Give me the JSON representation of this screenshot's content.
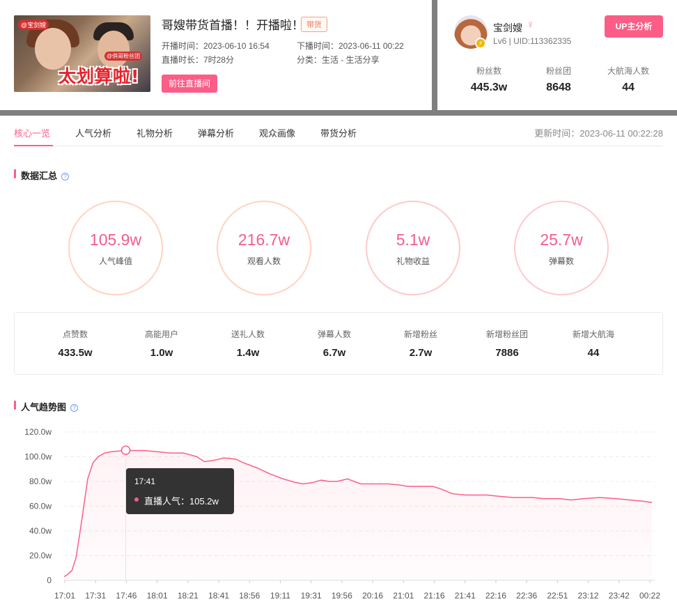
{
  "live": {
    "thumb_caption": "太划算啦!",
    "thumb_tag1": "@宝剑嫂",
    "thumb_tag2": "@俏哥粉丝团",
    "title": "哥嫂带货首播！！开播啦！",
    "badge": "带货",
    "start_time": "开播时间：2023-06-10 16:54",
    "end_time": "下播时间：2023-06-11 00:22",
    "duration": "直播时长：7时28分",
    "category": "分类：生活 - 生活分享",
    "go_button": "前往直播间"
  },
  "up": {
    "name": "宝剑嫂",
    "gender_icon": "♀",
    "uid": "Lv6 | UID:113362335",
    "analyze_button": "UP主分析",
    "stats": [
      {
        "label": "粉丝数",
        "value": "445.3w"
      },
      {
        "label": "粉丝团",
        "value": "8648"
      },
      {
        "label": "大航海人数",
        "value": "44"
      }
    ]
  },
  "tabs": [
    "核心一览",
    "人气分析",
    "礼物分析",
    "弹幕分析",
    "观众画像",
    "带货分析"
  ],
  "updated": "更新时间：2023-06-11 00:22:28",
  "summary": {
    "title": "数据汇总",
    "rings": [
      {
        "value": "105.9w",
        "label": "人气峰值"
      },
      {
        "value": "216.7w",
        "label": "观看人数"
      },
      {
        "value": "5.1w",
        "label": "礼物收益"
      },
      {
        "value": "25.7w",
        "label": "弹幕数"
      }
    ],
    "stats": [
      {
        "label": "点赞数",
        "value": "433.5w"
      },
      {
        "label": "高能用户",
        "value": "1.0w"
      },
      {
        "label": "送礼人数",
        "value": "1.4w"
      },
      {
        "label": "弹幕人数",
        "value": "6.7w"
      },
      {
        "label": "新增粉丝",
        "value": "2.7w"
      },
      {
        "label": "新增粉丝团",
        "value": "7886"
      },
      {
        "label": "新增大航海",
        "value": "44"
      }
    ]
  },
  "trend": {
    "title": "人气趋势图",
    "tooltip_time": "17:41",
    "tooltip_value": "直播人气：105.2w"
  },
  "chart_data": {
    "type": "area",
    "title": "人气趋势图",
    "xlabel": "",
    "ylabel": "",
    "ylim": [
      0,
      120
    ],
    "y_ticks": [
      "0",
      "20.0w",
      "40.0w",
      "60.0w",
      "80.0w",
      "100.0w",
      "120.0w"
    ],
    "x_ticks": [
      "17:01",
      "17:31",
      "17:46",
      "18:01",
      "18:21",
      "18:41",
      "18:56",
      "19:11",
      "19:31",
      "19:56",
      "20:16",
      "21:01",
      "21:16",
      "21:41",
      "22:16",
      "22:36",
      "22:51",
      "23:12",
      "23:42",
      "00:22"
    ],
    "grid": true,
    "color": "#fb5d87",
    "series": [
      {
        "name": "直播人气",
        "x": [
          "16:54",
          "16:57",
          "17:00",
          "17:03",
          "17:06",
          "17:09",
          "17:12",
          "17:16",
          "17:20",
          "17:25",
          "17:30",
          "17:35",
          "17:41",
          "17:46",
          "17:55",
          "18:05",
          "18:15",
          "18:25",
          "18:35",
          "18:41",
          "18:48",
          "18:56",
          "19:05",
          "19:11",
          "19:21",
          "19:31",
          "19:41",
          "19:51",
          "19:56",
          "20:03",
          "20:10",
          "20:16",
          "20:22",
          "20:30",
          "20:40",
          "20:50",
          "21:01",
          "21:10",
          "21:16",
          "21:25",
          "21:35",
          "21:41",
          "21:50",
          "22:00",
          "22:10",
          "22:16",
          "22:25",
          "22:36",
          "22:45",
          "22:51",
          "23:00",
          "23:12",
          "23:20",
          "23:30",
          "23:42",
          "23:55",
          "00:05",
          "00:15",
          "00:22"
        ],
        "values": [
          3,
          5,
          8,
          18,
          38,
          60,
          82,
          95,
          100,
          103,
          104,
          104.5,
          105.2,
          105,
          105,
          104,
          103,
          103,
          100,
          96,
          97,
          99,
          98,
          95,
          91,
          86,
          82,
          79,
          78,
          79,
          81,
          80,
          80,
          82,
          78,
          78,
          78,
          77,
          76,
          76,
          76,
          74,
          70,
          69,
          69,
          69,
          68,
          67,
          67,
          67,
          66,
          66,
          65,
          66,
          67,
          66,
          65,
          64,
          63
        ]
      }
    ]
  }
}
